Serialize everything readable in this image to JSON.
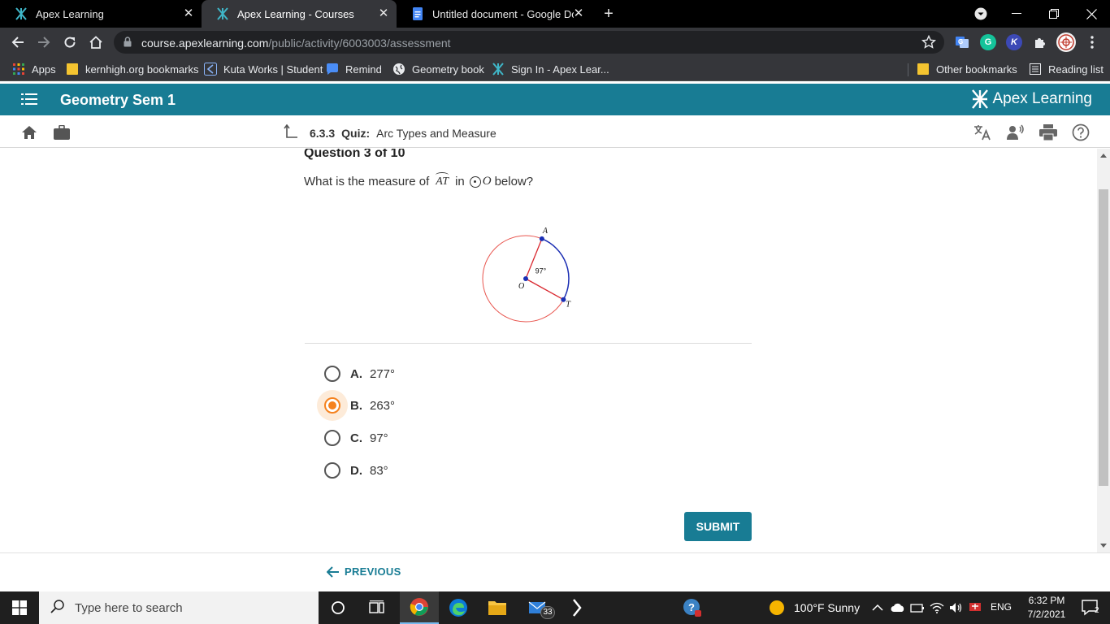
{
  "browser": {
    "tabs": [
      {
        "title": "Apex Learning",
        "active": false
      },
      {
        "title": "Apex Learning - Courses",
        "active": true
      },
      {
        "title": "Untitled document - Google Doc",
        "active": false
      }
    ],
    "url_host": "course.apexlearning.com",
    "url_path": "/public/activity/6003003/assessment",
    "bookmarks": [
      {
        "label": "Apps",
        "icon": "apps-grid-icon"
      },
      {
        "label": "kernhigh.org bookmarks",
        "icon": "folder-icon"
      },
      {
        "label": "Kuta Works | Student",
        "icon": "kuta-icon"
      },
      {
        "label": "Remind",
        "icon": "remind-icon"
      },
      {
        "label": "Geometry book",
        "icon": "globe-icon"
      },
      {
        "label": "Sign In - Apex Lear...",
        "icon": "apex-icon"
      }
    ],
    "other_bookmarks": "Other bookmarks",
    "reading_list": "Reading list",
    "extensions": [
      "G",
      "K"
    ]
  },
  "apex": {
    "course_title": "Geometry Sem 1",
    "logo_text": "Apex Learning",
    "activity_number": "6.3.3",
    "activity_type": "Quiz:",
    "activity_name": "Arc Types and Measure"
  },
  "question": {
    "header": "Question 3 of 10",
    "text_before": "What is the measure of",
    "arc_name": "AT",
    "text_in": "in",
    "circle_name": "O",
    "text_after": "below?"
  },
  "diagram": {
    "point_a": "A",
    "point_t": "T",
    "center": "O",
    "angle_label": "97°",
    "central_angle": 97,
    "colors": {
      "circle": "#e8554e",
      "arc": "#1a2fb5",
      "radius": "#d9282f",
      "point": "#1a2fb5"
    }
  },
  "options": [
    {
      "letter": "A.",
      "value": "277°",
      "selected": false
    },
    {
      "letter": "B.",
      "value": "263°",
      "selected": true
    },
    {
      "letter": "C.",
      "value": "97°",
      "selected": false
    },
    {
      "letter": "D.",
      "value": "83°",
      "selected": false
    }
  ],
  "submit_label": "SUBMIT",
  "previous_label": "PREVIOUS",
  "taskbar": {
    "search_placeholder": "Type here to search",
    "mail_badge": "33",
    "weather": "100°F  Sunny",
    "language": "ENG",
    "time": "6:32 PM",
    "date": "7/2/2021",
    "notifications": "2"
  },
  "theme": {
    "apex_teal": "#187c94",
    "selected_orange": "#f5821f"
  }
}
